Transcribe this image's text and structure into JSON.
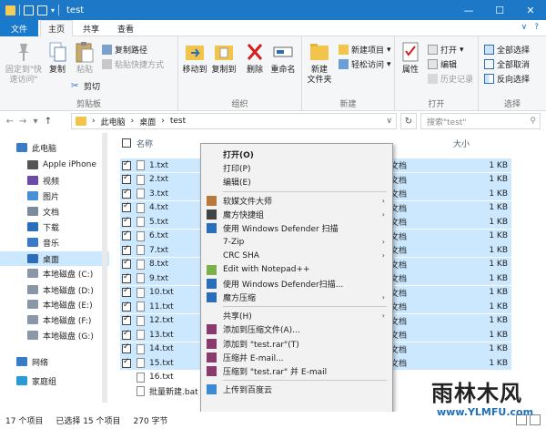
{
  "window": {
    "title": "test"
  },
  "tabs": [
    {
      "label": "文件"
    },
    {
      "label": "主页"
    },
    {
      "label": "共享"
    },
    {
      "label": "查看"
    }
  ],
  "ribbon": {
    "clipboard": {
      "label": "剪贴板",
      "pin": "固定到\"快\n速访问\"",
      "copy": "复制",
      "paste": "粘贴",
      "copy_path": "复制路径",
      "paste_shortcut": "粘贴快捷方式",
      "cut": "剪切"
    },
    "organize": {
      "label": "组织",
      "move_to": "移动到",
      "copy_to": "复制到",
      "delete": "删除",
      "rename": "重命名"
    },
    "new": {
      "label": "新建",
      "new_folder": "新建\n文件夹",
      "new_item": "新建项目",
      "easy_access": "轻松访问"
    },
    "open": {
      "label": "打开",
      "properties": "属性",
      "open": "打开",
      "edit": "编辑",
      "history": "历史记录"
    },
    "select": {
      "label": "选择",
      "select_all": "全部选择",
      "select_none": "全部取消",
      "invert": "反向选择"
    }
  },
  "address": {
    "path": [
      "此电脑",
      "桌面",
      "test"
    ],
    "search_placeholder": "搜索\"test\""
  },
  "nav": [
    {
      "label": "此电脑",
      "icon": "computer-icon"
    },
    {
      "label": "Apple iPhone",
      "icon": "phone-icon"
    },
    {
      "label": "视频",
      "icon": "video-icon"
    },
    {
      "label": "图片",
      "icon": "pictures-icon"
    },
    {
      "label": "文档",
      "icon": "documents-icon"
    },
    {
      "label": "下载",
      "icon": "download-icon"
    },
    {
      "label": "音乐",
      "icon": "music-icon"
    },
    {
      "label": "桌面",
      "icon": "desktop-icon"
    },
    {
      "label": "本地磁盘 (C:)",
      "icon": "drive-icon"
    },
    {
      "label": "本地磁盘 (D:)",
      "icon": "drive-icon"
    },
    {
      "label": "本地磁盘 (E:)",
      "icon": "drive-icon"
    },
    {
      "label": "本地磁盘 (F:)",
      "icon": "drive-icon"
    },
    {
      "label": "本地磁盘 (G:)",
      "icon": "drive-icon"
    },
    {
      "label": "网络",
      "icon": "network-icon"
    },
    {
      "label": "家庭组",
      "icon": "homegroup-icon"
    }
  ],
  "columns": {
    "name": "名称",
    "size": "大小"
  },
  "files": [
    {
      "name": "1.txt",
      "type": "文档",
      "size": "1 KB",
      "selected": true
    },
    {
      "name": "2.txt",
      "type": "文档",
      "size": "1 KB",
      "selected": true
    },
    {
      "name": "3.txt",
      "type": "文档",
      "size": "1 KB",
      "selected": true
    },
    {
      "name": "4.txt",
      "type": "文档",
      "size": "1 KB",
      "selected": true
    },
    {
      "name": "5.txt",
      "type": "文档",
      "size": "1 KB",
      "selected": true
    },
    {
      "name": "6.txt",
      "type": "文档",
      "size": "1 KB",
      "selected": true
    },
    {
      "name": "7.txt",
      "type": "文档",
      "size": "1 KB",
      "selected": true
    },
    {
      "name": "8.txt",
      "type": "文档",
      "size": "1 KB",
      "selected": true
    },
    {
      "name": "9.txt",
      "type": "文档",
      "size": "1 KB",
      "selected": true
    },
    {
      "name": "10.txt",
      "type": "文档",
      "size": "1 KB",
      "selected": true
    },
    {
      "name": "11.txt",
      "type": "文档",
      "size": "1 KB",
      "selected": true
    },
    {
      "name": "12.txt",
      "type": "文档",
      "size": "1 KB",
      "selected": true
    },
    {
      "name": "13.txt",
      "type": "文档",
      "size": "1 KB",
      "selected": true
    },
    {
      "name": "14.txt",
      "type": "文档",
      "size": "1 KB",
      "selected": true
    },
    {
      "name": "15.txt",
      "type": "文档",
      "size": "1 KB",
      "selected": true
    },
    {
      "name": "16.txt",
      "type": "",
      "size": "",
      "selected": false
    },
    {
      "name": "批量新建.bat",
      "type": "",
      "size": "",
      "selected": false
    }
  ],
  "context_menu": [
    {
      "label": "打开(O)",
      "bold": true
    },
    {
      "label": "打印(P)"
    },
    {
      "label": "编辑(E)"
    },
    {
      "sep": true
    },
    {
      "label": "软媒文件大师",
      "submenu": true,
      "icon": "rm-icon"
    },
    {
      "label": "魔方快捷组",
      "submenu": true,
      "icon": "grid-icon"
    },
    {
      "label": "使用 Windows Defender 扫描",
      "icon": "defender-icon"
    },
    {
      "label": "7-Zip",
      "submenu": true
    },
    {
      "label": "CRC SHA",
      "submenu": true
    },
    {
      "label": "Edit with Notepad++",
      "icon": "notepad-icon"
    },
    {
      "label": "使用 Windows Defender扫描...",
      "icon": "defender-icon"
    },
    {
      "label": "魔方压缩",
      "submenu": true,
      "icon": "cube-icon"
    },
    {
      "sep": true
    },
    {
      "label": "共享(H)",
      "submenu": true
    },
    {
      "label": "添加到压缩文件(A)...",
      "icon": "rar-icon"
    },
    {
      "label": "添加到 \"test.rar\"(T)",
      "icon": "rar-icon"
    },
    {
      "label": "压缩并 E-mail...",
      "icon": "rar-icon"
    },
    {
      "label": "压缩到 \"test.rar\" 并 E-mail",
      "icon": "rar-icon"
    },
    {
      "sep": true
    },
    {
      "label": "上传到百度云",
      "icon": "cloud-icon"
    }
  ],
  "status": {
    "count": "17 个项目",
    "selected": "已选择 15 个项目",
    "size": "270 字节"
  },
  "watermark": {
    "text": "雨林木风",
    "url": "www.YLMFU.com"
  }
}
